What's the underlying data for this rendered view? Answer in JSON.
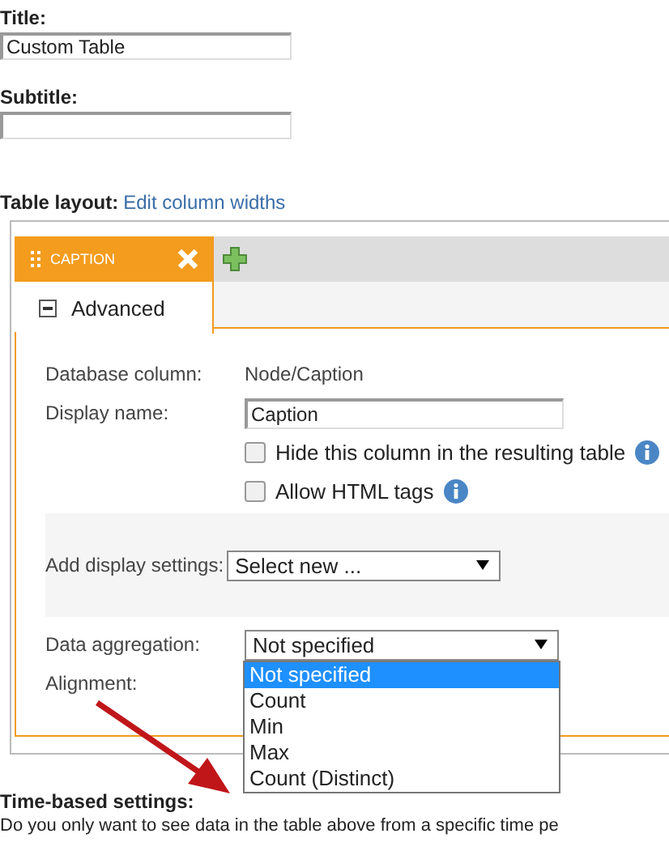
{
  "title_field": {
    "label": "Title:",
    "value": "Custom Table"
  },
  "subtitle_field": {
    "label": "Subtitle:"
  },
  "table_layout": {
    "label": "Table layout:",
    "link": "Edit column widths"
  },
  "column_tab": {
    "label": "CAPTION",
    "selected": true
  },
  "section": {
    "label": "Advanced",
    "expanded": true
  },
  "database_column": {
    "label": "Database column:",
    "value": "Node/Caption"
  },
  "display_name": {
    "label": "Display name:",
    "value": "Caption"
  },
  "checkboxes": [
    {
      "label": "Hide this column in the resulting table",
      "checked": false
    },
    {
      "label": "Allow HTML tags",
      "checked": false
    }
  ],
  "display_settings": {
    "label": "Add display settings:",
    "value": "Select new ..."
  },
  "data_aggregation": {
    "label": "Data aggregation:",
    "value": "Not specified",
    "options": [
      {
        "label": "Not specified",
        "selected": true
      },
      {
        "label": "Count",
        "selected": false
      },
      {
        "label": "Min",
        "selected": false
      },
      {
        "label": "Max",
        "selected": false
      },
      {
        "label": "Count (Distinct)",
        "selected": false
      }
    ]
  },
  "alignment": {
    "label": "Alignment:"
  },
  "time_settings": {
    "heading": "Time-based settings:",
    "text": "Do you only want to see data in the table above from a specific time pe"
  }
}
